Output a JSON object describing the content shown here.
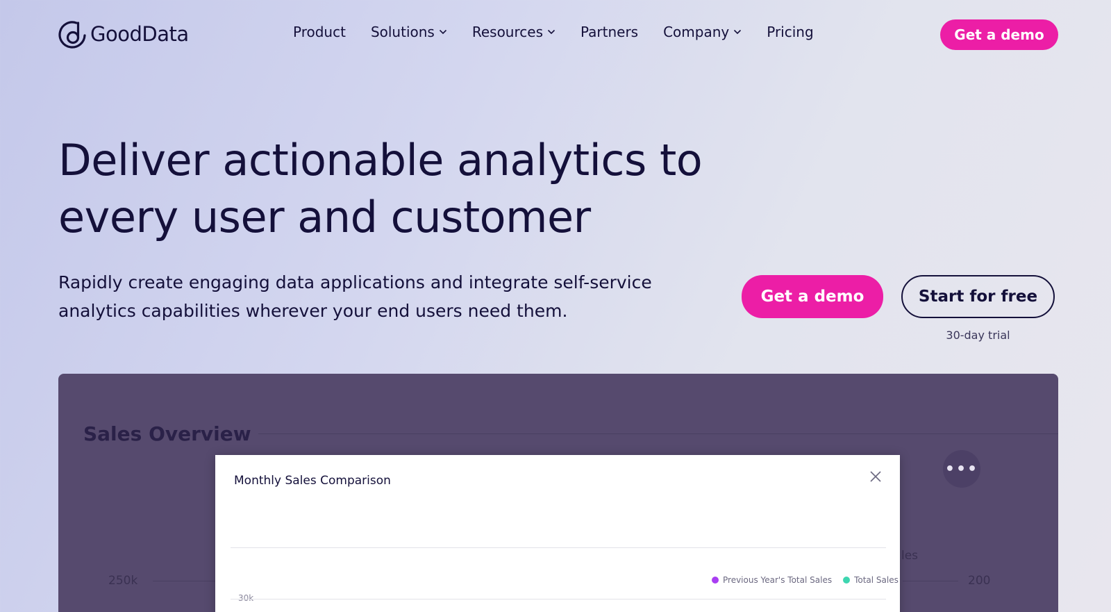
{
  "brand": {
    "name": "GoodData",
    "accent": "#ec1ea6",
    "text_color": "#14103a"
  },
  "nav": {
    "items": [
      {
        "label": "Product",
        "has_dropdown": false
      },
      {
        "label": "Solutions",
        "has_dropdown": true
      },
      {
        "label": "Resources",
        "has_dropdown": true
      },
      {
        "label": "Partners",
        "has_dropdown": false
      },
      {
        "label": "Company",
        "has_dropdown": true
      },
      {
        "label": "Pricing",
        "has_dropdown": false
      }
    ],
    "cta_label": "Get a demo"
  },
  "hero": {
    "title_line1": "Deliver actionable analytics to",
    "title_line2": "every user and customer",
    "subtitle_line1": "Rapidly create engaging data applications and integrate self-service",
    "subtitle_line2": "analytics capabilities wherever your end users need them.",
    "demo_label": "Get a demo",
    "free_label": "Start for free",
    "trial_note": "30-day trial"
  },
  "dashboard": {
    "title": "Sales Overview",
    "menu_icon": "ellipsis-icon",
    "left_tick": "250k",
    "right_tick": "200",
    "partial_label": "les",
    "modal": {
      "title": "Monthly Sales Comparison",
      "close_icon": "close-icon",
      "y_tick": "30k",
      "legend": [
        {
          "label": "Previous Year's Total Sales",
          "color": "#a93ef2"
        },
        {
          "label": "Total Sales",
          "color": "#3ed6b0"
        }
      ]
    }
  }
}
